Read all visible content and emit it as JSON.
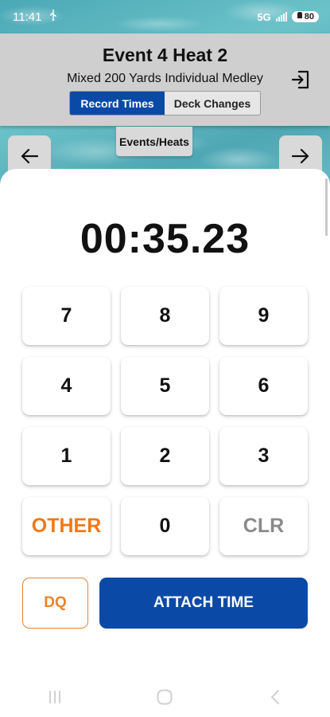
{
  "status_bar": {
    "time": "11:41",
    "network": "5G",
    "battery": "80"
  },
  "header": {
    "title": "Event 4 Heat 2",
    "subtitle": "Mixed 200 Yards Individual Medley",
    "tabs": [
      {
        "label": "Record Times",
        "active": true
      },
      {
        "label": "Deck Changes",
        "active": false
      }
    ],
    "events_heats_label": "Events/Heats"
  },
  "timer": {
    "value": "00:35.23"
  },
  "keypad": {
    "keys": [
      "7",
      "8",
      "9",
      "4",
      "5",
      "6",
      "1",
      "2",
      "3",
      "OTHER",
      "0",
      "CLR"
    ]
  },
  "actions": {
    "dq_label": "DQ",
    "attach_label": "ATTACH TIME"
  },
  "colors": {
    "primary": "#0a4aa6",
    "accent_orange": "#f07818",
    "muted": "#8a8a8a"
  }
}
